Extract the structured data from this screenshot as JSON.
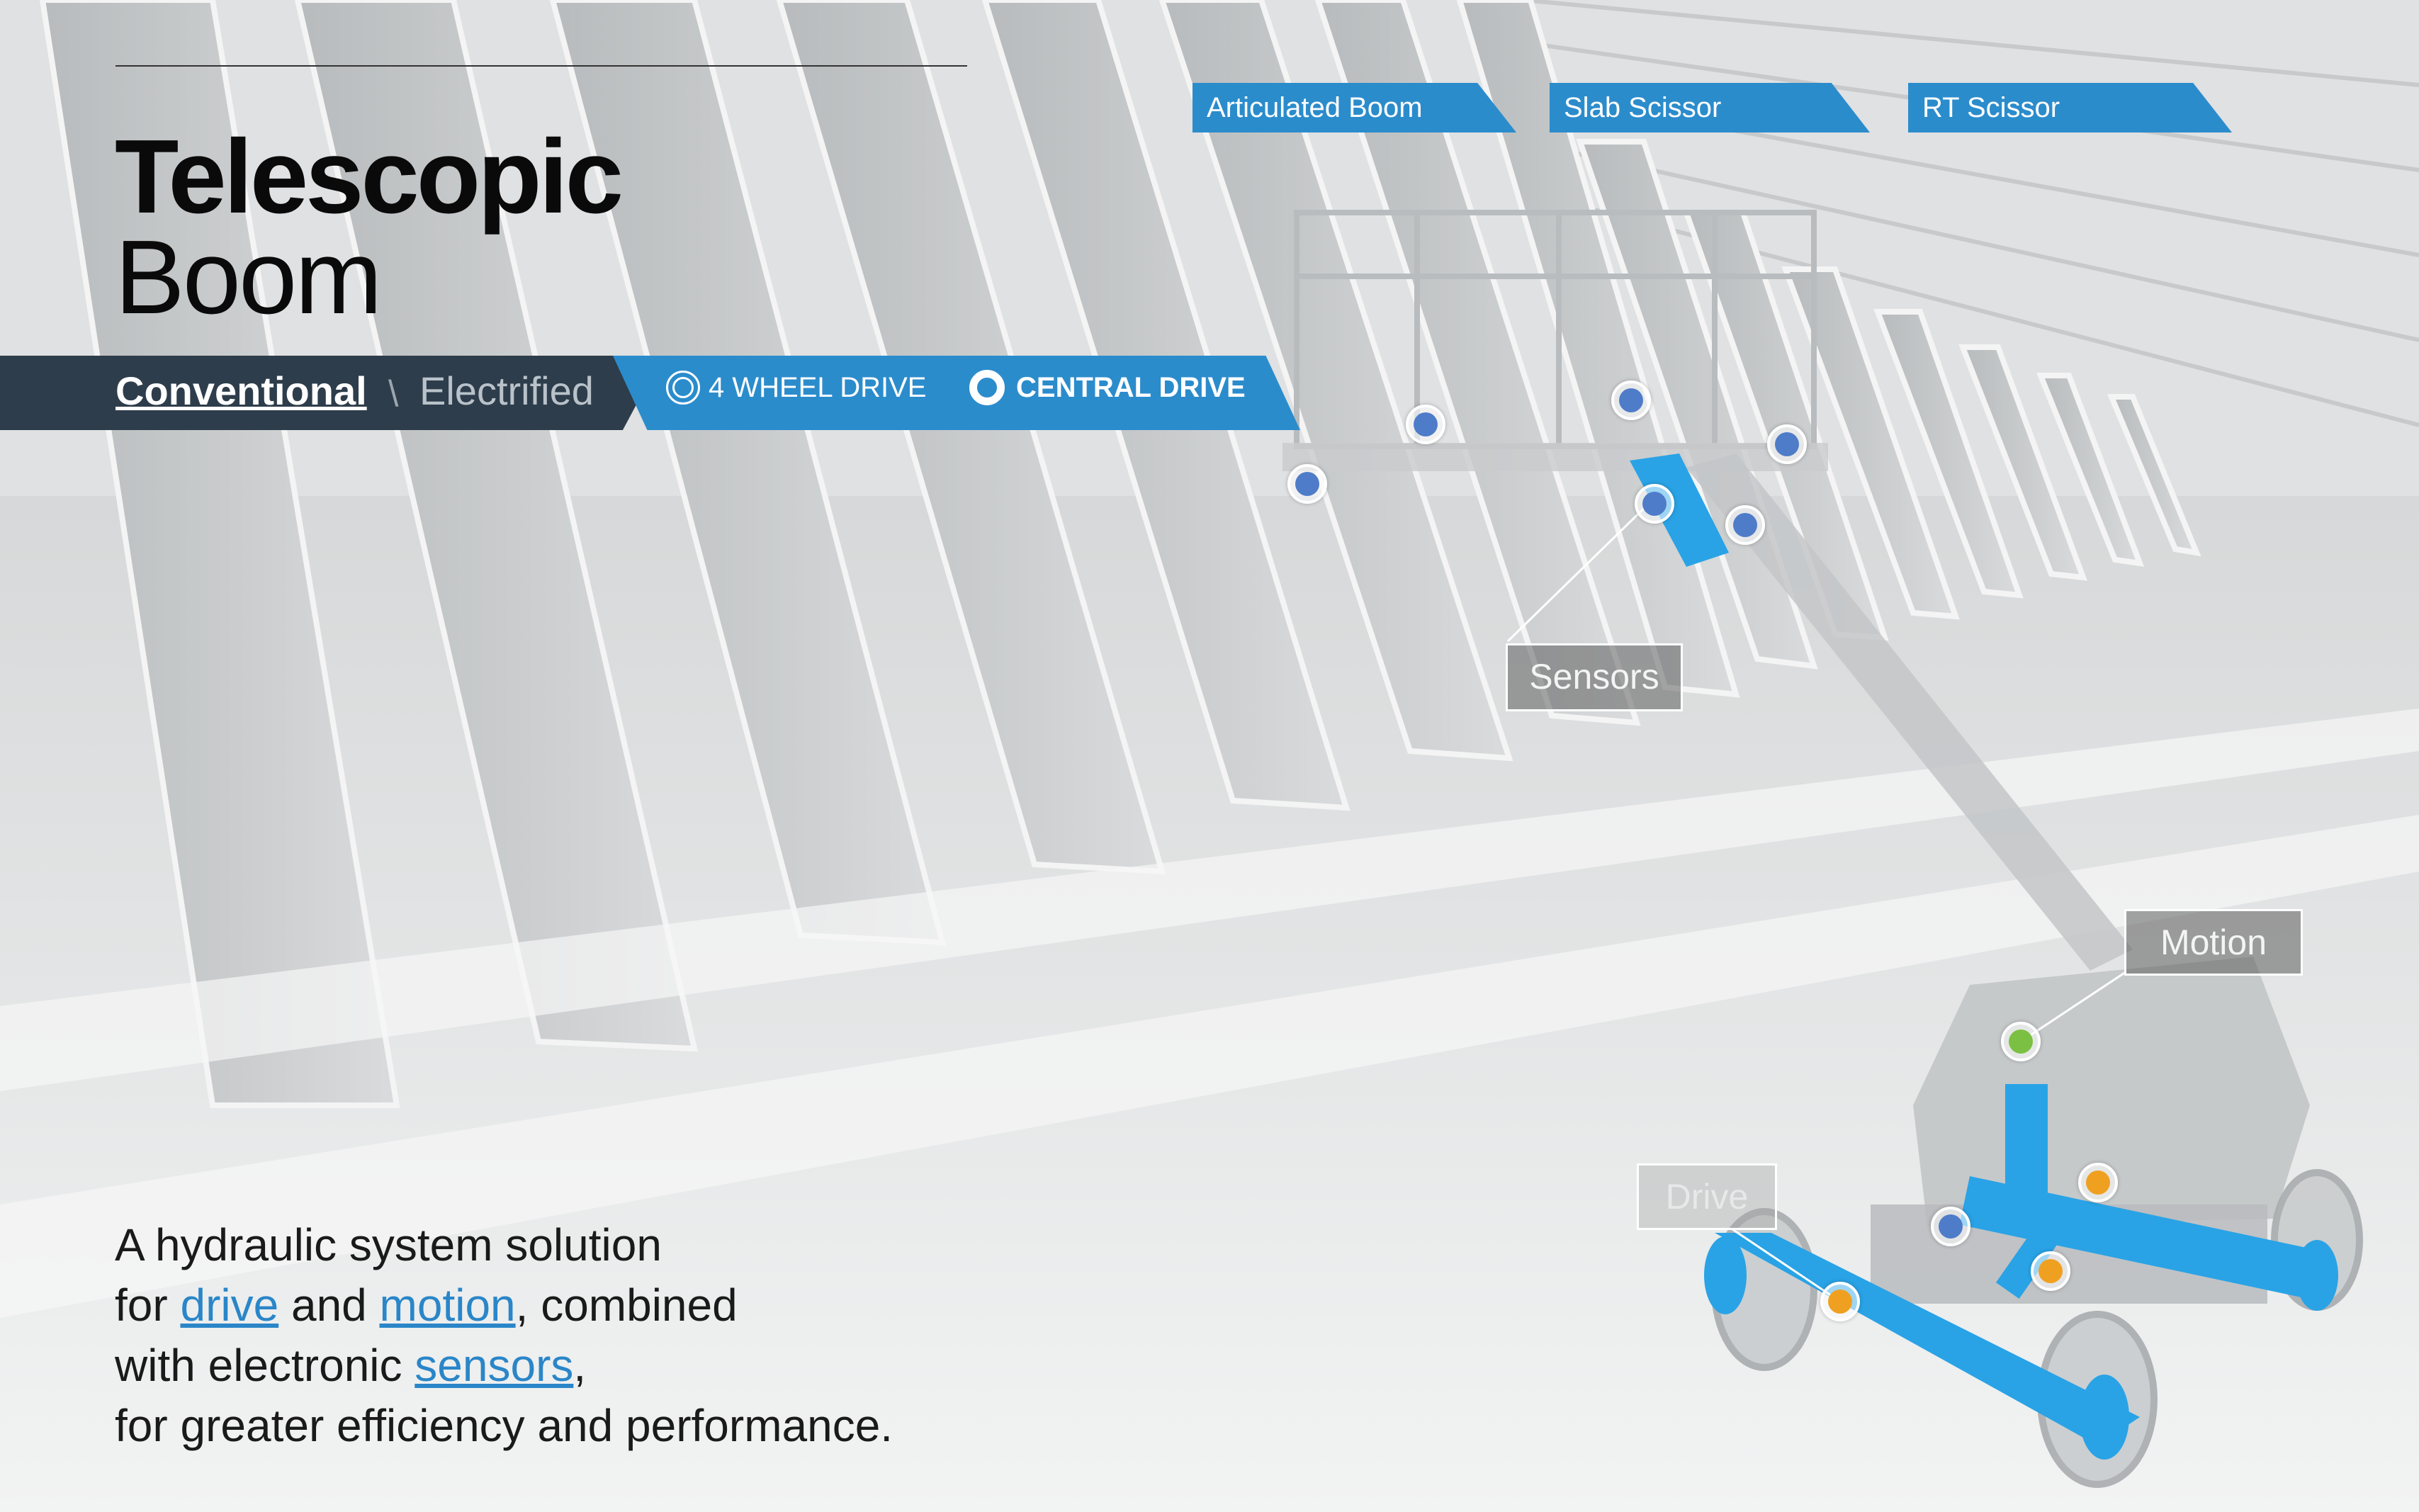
{
  "header": {
    "title_bold": "Telescopic",
    "title_light": "Boom"
  },
  "product_tabs": [
    {
      "label": "Articulated Boom"
    },
    {
      "label": "Slab Scissor"
    },
    {
      "label": "RT Scissor"
    }
  ],
  "variant_tabs": {
    "active": "Conventional",
    "separator": "\\",
    "inactive": "Electrified"
  },
  "drive_options": [
    {
      "label": "4 WHEEL DRIVE",
      "selected": false
    },
    {
      "label": "CENTRAL DRIVE",
      "selected": true
    }
  ],
  "callouts": {
    "sensors": "Sensors",
    "motion": "Motion",
    "drive": "Drive"
  },
  "hotspot_colors": {
    "sensor": "#4f7cc9",
    "motion": "#7cc043",
    "drive": "#f0a020"
  },
  "description": {
    "line1": "A hydraulic system solution",
    "line2_pre": "for ",
    "link_drive": "drive",
    "line2_mid": " and ",
    "link_motion": "motion",
    "line2_post": ", combined",
    "line3_pre": "with electronic ",
    "link_sensors": "sensors",
    "line3_post": ",",
    "line4": "for greater efficiency and performance."
  },
  "colors": {
    "accent_blue": "#2b8ccc",
    "dark_bar": "#2e3d4b",
    "link": "#2a86c8",
    "hydraulic_blue": "#29a3e6"
  }
}
